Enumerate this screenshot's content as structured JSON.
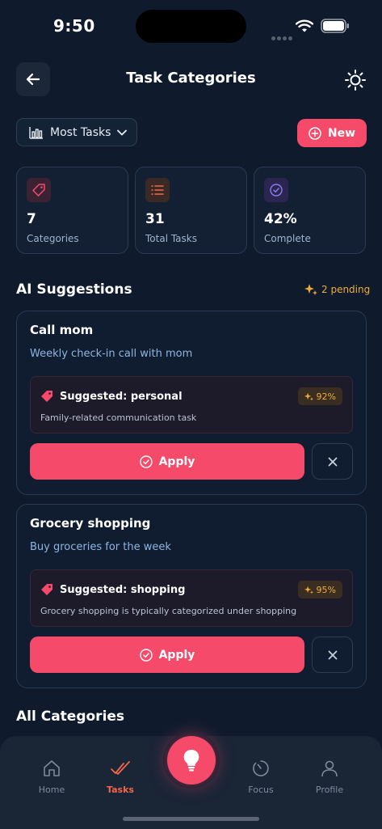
{
  "status_bar": {
    "time": "9:50"
  },
  "header": {
    "title": "Task Categories"
  },
  "controls": {
    "sort_label": "Most Tasks",
    "new_label": "New"
  },
  "stats": [
    {
      "value": "7",
      "label": "Categories"
    },
    {
      "value": "31",
      "label": "Total Tasks"
    },
    {
      "value": "42%",
      "label": "Complete"
    }
  ],
  "ai_section": {
    "title": "AI Suggestions",
    "pending": "2 pending"
  },
  "suggestions": [
    {
      "title": "Call mom",
      "description": "Weekly check-in call with mom",
      "suggested": "Suggested: personal",
      "confidence": "92%",
      "reason": "Family-related communication task",
      "apply_label": "Apply"
    },
    {
      "title": "Grocery shopping",
      "description": "Buy groceries for the week",
      "suggested": "Suggested: shopping",
      "confidence": "95%",
      "reason": "Grocery shopping is typically categorized under shopping",
      "apply_label": "Apply"
    }
  ],
  "all_categories": {
    "title": "All Categories"
  },
  "tabbar": {
    "items": [
      {
        "label": "Home",
        "icon": "home-icon"
      },
      {
        "label": "Tasks",
        "icon": "tasks-check-icon"
      },
      {
        "label": "Focus",
        "icon": "focus-timer-icon"
      },
      {
        "label": "Profile",
        "icon": "profile-icon"
      }
    ],
    "active": "Tasks",
    "center_icon": "lightbulb-icon"
  },
  "colors": {
    "background": "#0f1b2d",
    "accent": "#f64a6a",
    "pending": "#f0ad3a",
    "link": "#8fb5e0"
  }
}
